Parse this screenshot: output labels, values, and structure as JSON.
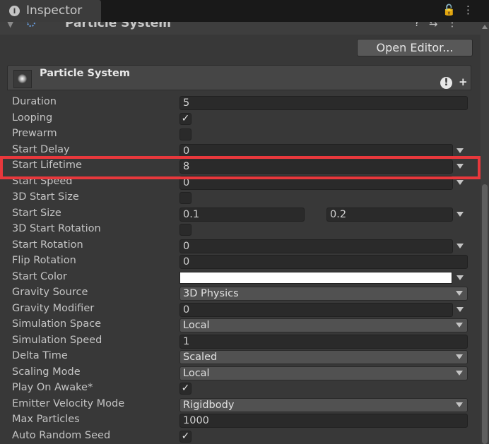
{
  "window": {
    "tab_title": "Inspector",
    "tab_icon": "info-icon",
    "tool_icons": [
      "lock-icon",
      "more-menu-icon"
    ]
  },
  "component_header": {
    "title": "Particle System",
    "icons": [
      "help-icon",
      "preset-icon",
      "more-menu-icon"
    ]
  },
  "open_editor_label": "Open Editor...",
  "module": {
    "title": "Particle System",
    "icons": [
      "warning-icon",
      "add-icon"
    ]
  },
  "fields": {
    "duration": {
      "label": "Duration",
      "value": "5"
    },
    "looping": {
      "label": "Looping",
      "checked": true,
      "mark": "✓"
    },
    "prewarm": {
      "label": "Prewarm",
      "checked": false
    },
    "start_delay": {
      "label": "Start Delay",
      "value": "0"
    },
    "start_lifetime": {
      "label": "Start Lifetime",
      "value": "8"
    },
    "start_speed": {
      "label": "Start Speed",
      "value": "0"
    },
    "start_size_3d": {
      "label": "3D Start Size",
      "checked": false
    },
    "start_size": {
      "label": "Start Size",
      "min": "0.1",
      "max": "0.2"
    },
    "start_rotation_3d": {
      "label": "3D Start Rotation",
      "checked": false
    },
    "start_rotation": {
      "label": "Start Rotation",
      "value": "0"
    },
    "flip_rotation": {
      "label": "Flip Rotation",
      "value": "0"
    },
    "start_color": {
      "label": "Start Color",
      "color": "#ffffff"
    },
    "gravity_source": {
      "label": "Gravity Source",
      "value": "3D Physics"
    },
    "gravity_modifier": {
      "label": "Gravity Modifier",
      "value": "0"
    },
    "simulation_space": {
      "label": "Simulation Space",
      "value": "Local"
    },
    "simulation_speed": {
      "label": "Simulation Speed",
      "value": "1"
    },
    "delta_time": {
      "label": "Delta Time",
      "value": "Scaled"
    },
    "scaling_mode": {
      "label": "Scaling Mode",
      "value": "Local"
    },
    "play_on_awake": {
      "label": "Play On Awake*",
      "checked": true,
      "mark": "✓"
    },
    "emitter_velocity_mode": {
      "label": "Emitter Velocity Mode",
      "value": "Rigidbody"
    },
    "max_particles": {
      "label": "Max Particles",
      "value": "1000"
    },
    "auto_random_seed": {
      "label": "Auto Random Seed",
      "checked": true,
      "mark": "✓"
    }
  },
  "colors": {
    "highlight": "#e8383c",
    "panel": "#383838",
    "field": "#2a2a2a"
  }
}
